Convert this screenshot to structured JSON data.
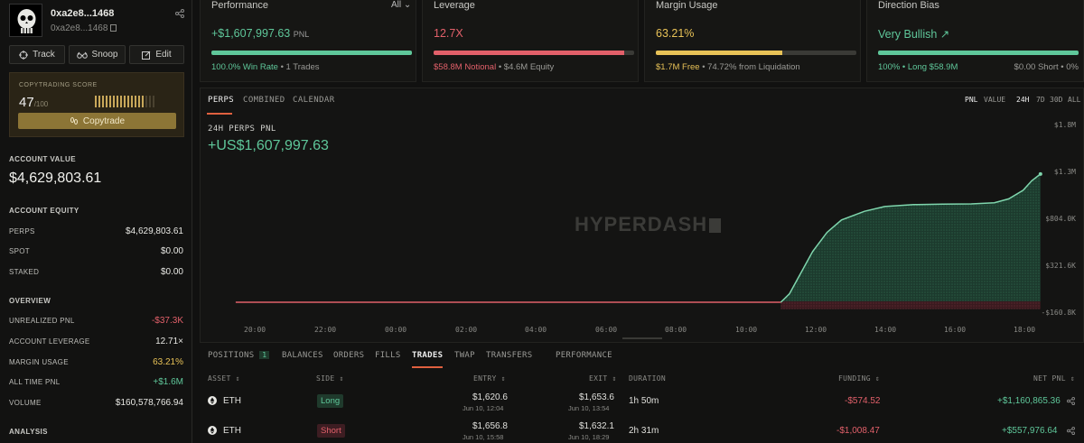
{
  "profile": {
    "title": "0xa2e8...1468",
    "address": "0xa2e8...1468"
  },
  "actions": {
    "track": "Track",
    "snoop": "Snoop",
    "edit": "Edit"
  },
  "score": {
    "label": "COPYTRADING SCORE",
    "value": "47",
    "max": "/100",
    "button": "Copytrade",
    "filled_bars": 14,
    "total_bars": 17
  },
  "account_value": {
    "label": "ACCOUNT VALUE",
    "value": "$4,629,803.61"
  },
  "equity": {
    "label": "ACCOUNT EQUITY",
    "rows": [
      {
        "k": "PERPS",
        "v": "$4,629,803.61"
      },
      {
        "k": "SPOT",
        "v": "$0.00"
      },
      {
        "k": "STAKED",
        "v": "$0.00"
      }
    ]
  },
  "overview": {
    "label": "OVERVIEW",
    "rows": [
      {
        "k": "UNREALIZED PNL",
        "v": "-$37.3K"
      },
      {
        "k": "ACCOUNT LEVERAGE",
        "v": "12.71×"
      },
      {
        "k": "MARGIN USAGE",
        "v": "63.21%"
      },
      {
        "k": "ALL TIME PNL",
        "v": "+$1.6M"
      },
      {
        "k": "VOLUME",
        "v": "$160,578,766.94"
      }
    ]
  },
  "analysis_label": "ANALYSIS",
  "cards": {
    "performance": {
      "title": "Performance",
      "filter": "All",
      "main": "+$1,607,997.63",
      "unit": "PNL",
      "fill": 1.0,
      "sub_a": "100.0% Win Rate",
      "sub_b": "• 1 Trades"
    },
    "leverage": {
      "title": "Leverage",
      "main": "12.7X",
      "fill": 0.95,
      "sub_a": "$58.8M Notional",
      "sub_b": "• $4.6M Equity"
    },
    "margin": {
      "title": "Margin Usage",
      "main": "63.21%",
      "fill": 0.6321,
      "sub_a": "$1.7M Free",
      "sub_b": "• 74.72% from Liquidation"
    },
    "direction": {
      "title": "Direction Bias",
      "main": "Very Bullish ↗",
      "fill": 1.0,
      "sub_a": "100% • Long $58.9M",
      "sub_b": "$0.00 Short • 0%"
    }
  },
  "chart_tabs": [
    "PERPS",
    "COMBINED",
    "CALENDAR"
  ],
  "chart_right_tabs": [
    "PNL",
    "VALUE",
    "24H",
    "7D",
    "30D",
    "ALL"
  ],
  "chart_title": "24H PERPS PNL",
  "chart_pnl": "+US$1,607,997.63",
  "watermark": "HYPERDASH",
  "chart_data": {
    "type": "area",
    "title": "24H PERPS PNL",
    "xlabel": "",
    "ylabel": "",
    "x_ticks": [
      "20:00",
      "22:00",
      "00:00",
      "02:00",
      "04:00",
      "06:00",
      "08:00",
      "10:00",
      "12:00",
      "14:00",
      "16:00",
      "18:00"
    ],
    "y_ticks": [
      "$1.8M",
      "$1.3M",
      "$804.0K",
      "$321.6K",
      "-$160.8K"
    ],
    "ylim": [
      -160800,
      1800000
    ],
    "x": [
      19.0,
      20,
      22,
      24,
      26,
      28,
      30,
      32,
      34,
      36,
      37.9,
      38.2,
      38.6,
      39.0,
      39.5,
      40.0,
      40.8,
      41.5,
      42.5,
      43.5,
      44.5,
      45.3,
      45.8,
      46.3,
      46.6,
      46.9
    ],
    "values": [
      -10000,
      -10000,
      -10000,
      -10000,
      -10000,
      -10000,
      -10000,
      -10000,
      -10000,
      -10000,
      -10000,
      80000,
      300000,
      520000,
      720000,
      850000,
      940000,
      990000,
      1010000,
      1015000,
      1018000,
      1030000,
      1070000,
      1160000,
      1260000,
      1330000
    ],
    "grid": false
  },
  "trade_tabs": [
    {
      "label": "POSITIONS",
      "count": "1"
    },
    {
      "label": "BALANCES"
    },
    {
      "label": "ORDERS"
    },
    {
      "label": "FILLS"
    },
    {
      "label": "TRADES"
    },
    {
      "label": "TWAP"
    },
    {
      "label": "TRANSFERS"
    },
    {
      "label": "PERFORMANCE"
    }
  ],
  "table": {
    "headers": [
      "ASSET",
      "SIDE",
      "ENTRY",
      "EXIT",
      "DURATION",
      "FUNDING",
      "NET PNL"
    ],
    "rows": [
      {
        "asset": "ETH",
        "side": "Long",
        "entry": "$1,620.6",
        "entry_time": "Jun 10, 12:04",
        "exit": "$1,653.6",
        "exit_time": "Jun 10, 13:54",
        "duration": "1h 50m",
        "funding": "-$574.52",
        "pnl": "+$1,160,865.36"
      },
      {
        "asset": "ETH",
        "side": "Short",
        "entry": "$1,656.8",
        "entry_time": "Jun 10, 15:58",
        "exit": "$1,632.1",
        "exit_time": "Jun 10, 18:29",
        "duration": "2h 31m",
        "funding": "-$1,008.47",
        "pnl": "+$557,976.64"
      }
    ]
  },
  "colors": {
    "green": "#5fc79a",
    "red": "#e2606a",
    "yellow": "#e8c257",
    "accent": "#e0603f"
  }
}
